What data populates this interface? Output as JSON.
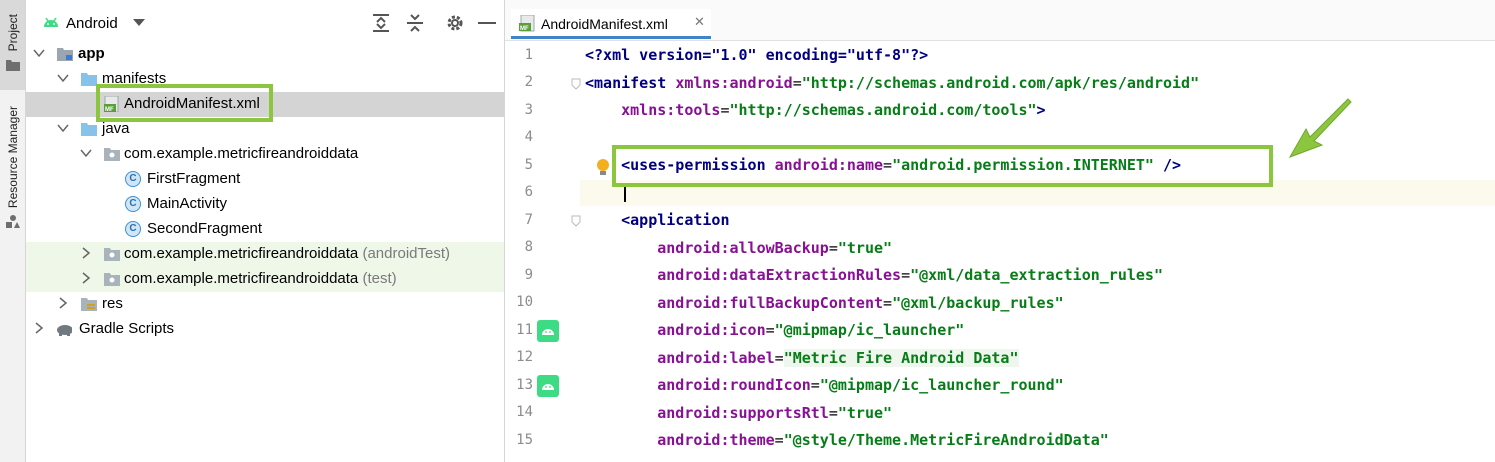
{
  "toolstrip": {
    "project_label": "Project",
    "resource_manager_label": "Resource Manager"
  },
  "panel": {
    "view_mode": "Android",
    "tree": [
      {
        "label": "app",
        "indent": 0,
        "expanded": true,
        "bold": true
      },
      {
        "label": "manifests",
        "indent": 1,
        "expanded": true
      },
      {
        "label": "AndroidManifest.xml",
        "indent": 2,
        "selected": true
      },
      {
        "label": "java",
        "indent": 1,
        "expanded": true
      },
      {
        "label": "com.example.metricfireandroiddata",
        "indent": 2,
        "expanded": true
      },
      {
        "label": "FirstFragment",
        "indent": 3
      },
      {
        "label": "MainActivity",
        "indent": 3
      },
      {
        "label": "SecondFragment",
        "indent": 3
      },
      {
        "label": "com.example.metricfireandroiddata",
        "suffix": "(androidTest)",
        "indent": 2,
        "expanded": false
      },
      {
        "label": "com.example.metricfireandroiddata",
        "suffix": "(test)",
        "indent": 2,
        "expanded": false
      },
      {
        "label": "res",
        "indent": 1,
        "expanded": false
      },
      {
        "label": "Gradle Scripts",
        "indent": 0,
        "expanded": false
      }
    ]
  },
  "editor": {
    "tab_label": "AndroidManifest.xml",
    "file_badge": "MF",
    "line_numbers": [
      "1",
      "2",
      "3",
      "4",
      "5",
      "6",
      "7",
      "8",
      "9",
      "10",
      "11",
      "12",
      "13",
      "14",
      "15"
    ],
    "code": {
      "l1": "<?xml version=\"1.0\" encoding=\"utf-8\"?>",
      "l2_tag": "<manifest",
      "l2_ns": "xmlns:android",
      "l2_val": "\"http://schemas.android.com/apk/res/android\"",
      "l3_ns": "xmlns:tools",
      "l3_val": "\"http://schemas.android.com/tools\"",
      "l3_end": ">",
      "l5_tag": "<uses-permission",
      "l5_attr": "android:name",
      "l5_val": "\"android.permission.INTERNET\"",
      "l5_end": " />",
      "l7_tag": "<application",
      "attrs": [
        {
          "name": "android:allowBackup",
          "value": "\"true\""
        },
        {
          "name": "android:dataExtractionRules",
          "value": "\"@xml/data_extraction_rules\""
        },
        {
          "name": "android:fullBackupContent",
          "value": "\"@xml/backup_rules\""
        },
        {
          "name": "android:icon",
          "value": "\"@mipmap/ic_launcher\""
        },
        {
          "name": "android:label",
          "value": "\"Metric Fire Android Data\""
        },
        {
          "name": "android:roundIcon",
          "value": "\"@mipmap/ic_launcher_round\""
        },
        {
          "name": "android:supportsRtl",
          "value": "\"true\""
        },
        {
          "name": "android:theme",
          "value": "\"@style/Theme.MetricFireAndroidData\""
        }
      ]
    }
  },
  "colors": {
    "highlight": "#8cc63f",
    "selection": "#d4d4d4",
    "tab_underline": "#4083c9"
  }
}
